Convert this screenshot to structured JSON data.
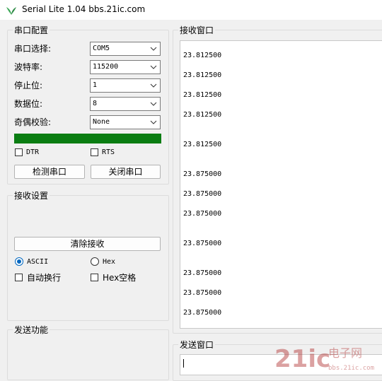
{
  "app": {
    "title": "Serial Lite 1.04 bbs.21ic.com",
    "icon": "leaf-icon"
  },
  "serial_config": {
    "title": "串口配置",
    "fields": [
      {
        "label": "串口选择:",
        "value": "COM5"
      },
      {
        "label": "波特率:",
        "value": "115200"
      },
      {
        "label": "停止位:",
        "value": "1"
      },
      {
        "label": "数据位:",
        "value": "8"
      },
      {
        "label": "奇偶校验:",
        "value": "None"
      }
    ],
    "progress_percent": 100,
    "progress_color": "#0a7d12",
    "dtr_label": "DTR",
    "dtr_checked": false,
    "rts_label": "RTS",
    "rts_checked": false,
    "detect_button": "检测串口",
    "close_button": "关闭串口"
  },
  "receive_settings": {
    "title": "接收设置",
    "clear_button": "清除接收",
    "ascii_label": "ASCII",
    "ascii_selected": true,
    "hex_label": "Hex",
    "hex_selected": false,
    "auto_wrap_label": "自动换行",
    "auto_wrap_checked": false,
    "hex_space_label": "Hex空格",
    "hex_space_checked": false
  },
  "send_function": {
    "title": "发送功能"
  },
  "receive_window": {
    "title": "接收窗口",
    "lines": [
      "23.812500",
      "23.812500",
      "23.812500",
      "23.812500",
      "23.812500",
      "23.875000",
      "23.875000",
      "23.875000",
      "23.875000",
      "23.875000",
      "23.875000",
      "23.875000"
    ]
  },
  "send_window": {
    "title": "发送窗口",
    "value": ""
  },
  "watermark": {
    "text": "21ic电子网"
  },
  "colors": {
    "accent": "#0067c0",
    "progress": "#0a7d12"
  }
}
